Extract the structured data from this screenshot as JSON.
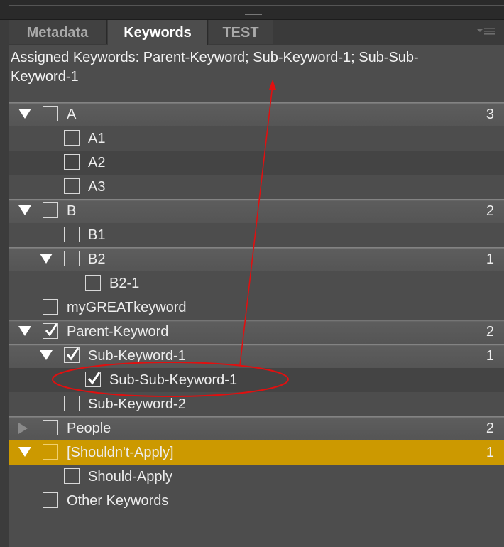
{
  "tabs": [
    {
      "label": "Metadata",
      "active": false
    },
    {
      "label": "Keywords",
      "active": true
    },
    {
      "label": "TEST",
      "active": false
    }
  ],
  "assigned_keywords_text": "Assigned Keywords: Parent-Keyword; Sub-Keyword-1; Sub-Sub-Keyword-1",
  "assigned_line_1": "Assigned Keywords: Parent-Keyword; Sub-Keyword-1; Sub-Sub-",
  "assigned_line_2": "Keyword-1",
  "keywords": [
    {
      "label": "A",
      "count": "3",
      "depth": 0,
      "expander": "expanded",
      "checked": false,
      "style": "parent"
    },
    {
      "label": "A1",
      "count": "",
      "depth": 1,
      "expander": "none",
      "checked": false,
      "style": "plain"
    },
    {
      "label": "A2",
      "count": "",
      "depth": 1,
      "expander": "none",
      "checked": false,
      "style": "alt"
    },
    {
      "label": "A3",
      "count": "",
      "depth": 1,
      "expander": "none",
      "checked": false,
      "style": "plain"
    },
    {
      "label": "B",
      "count": "2",
      "depth": 0,
      "expander": "expanded",
      "checked": false,
      "style": "parent"
    },
    {
      "label": "B1",
      "count": "",
      "depth": 1,
      "expander": "none",
      "checked": false,
      "style": "plain"
    },
    {
      "label": "B2",
      "count": "1",
      "depth": 1,
      "expander": "expanded",
      "checked": false,
      "style": "parent"
    },
    {
      "label": "B2-1",
      "count": "",
      "depth": 2,
      "expander": "none",
      "checked": false,
      "style": "plain"
    },
    {
      "label": "myGREATkeyword",
      "count": "",
      "depth": 0,
      "expander": "none",
      "checked": false,
      "style": "plain"
    },
    {
      "label": "Parent-Keyword",
      "count": "2",
      "depth": 0,
      "expander": "expanded",
      "checked": true,
      "style": "parent"
    },
    {
      "label": "Sub-Keyword-1",
      "count": "1",
      "depth": 1,
      "expander": "expanded",
      "checked": true,
      "style": "parent"
    },
    {
      "label": "Sub-Sub-Keyword-1",
      "count": "",
      "depth": 2,
      "expander": "none",
      "checked": true,
      "style": "alt"
    },
    {
      "label": "Sub-Keyword-2",
      "count": "",
      "depth": 1,
      "expander": "none",
      "checked": false,
      "style": "plain"
    },
    {
      "label": "People",
      "count": "2",
      "depth": 0,
      "expander": "collapsed",
      "checked": false,
      "style": "parent"
    },
    {
      "label": "[Shouldn't-Apply]",
      "count": "1",
      "depth": 0,
      "expander": "expanded",
      "checked": false,
      "style": "highlight"
    },
    {
      "label": "Should-Apply",
      "count": "",
      "depth": 1,
      "expander": "none",
      "checked": false,
      "style": "plain"
    },
    {
      "label": "Other Keywords",
      "count": "",
      "depth": 0,
      "expander": "none",
      "checked": false,
      "style": "plain"
    }
  ],
  "colors": {
    "highlight": "#cc9900",
    "annotation": "#e01010",
    "panel": "#4d4d4d"
  },
  "icons": {
    "expanded": "disclosure-triangle-down-icon",
    "collapsed": "disclosure-triangle-right-icon",
    "check": "checkmark-icon",
    "panel_menu": "panel-menu-icon"
  }
}
